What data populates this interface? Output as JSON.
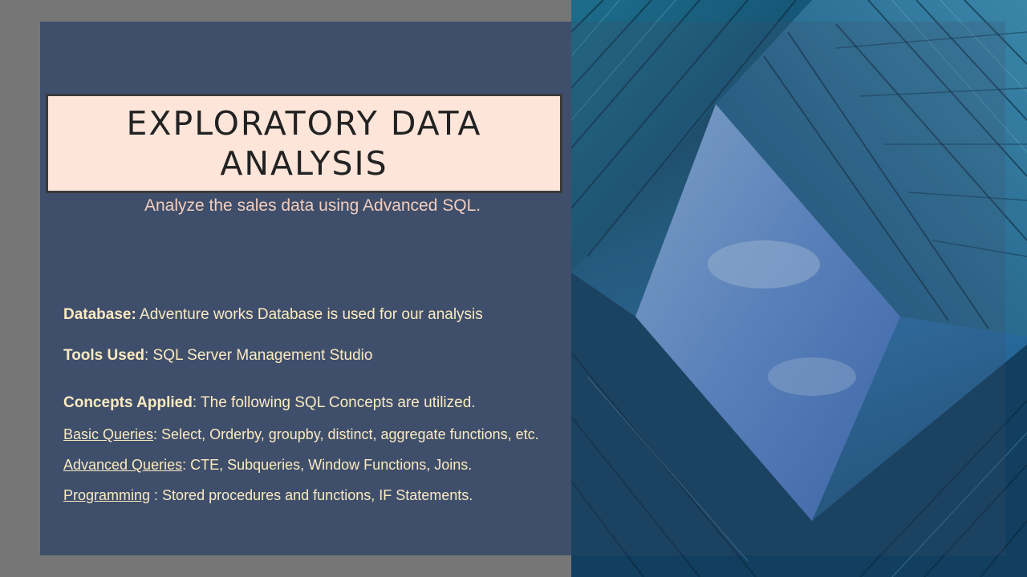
{
  "title": "EXPLORATORY DATA ANALYSIS",
  "subtitle": "Analyze the sales data using Advanced SQL.",
  "database": {
    "label": "Database:",
    "text": " Adventure works Database is used for our analysis"
  },
  "tools": {
    "label": "Tools Used",
    "text": ": SQL Server Management Studio"
  },
  "concepts": {
    "label": "Concepts Applied",
    "text": ": The following SQL Concepts are utilized."
  },
  "basic": {
    "label": "Basic Queries",
    "text": ": Select, Orderby, groupby, distinct, aggregate functions, etc."
  },
  "advanced": {
    "label": "Advanced Queries",
    "text": ": CTE, Subqueries, Window Functions, Joins."
  },
  "programming": {
    "label": "Programming",
    "text": " : Stored procedures and functions, IF Statements."
  },
  "colors": {
    "panel": "#3f4f6b",
    "title_box": "#fde5da",
    "subtitle": "#f4cdbd",
    "body_text": "#fbeac0"
  }
}
